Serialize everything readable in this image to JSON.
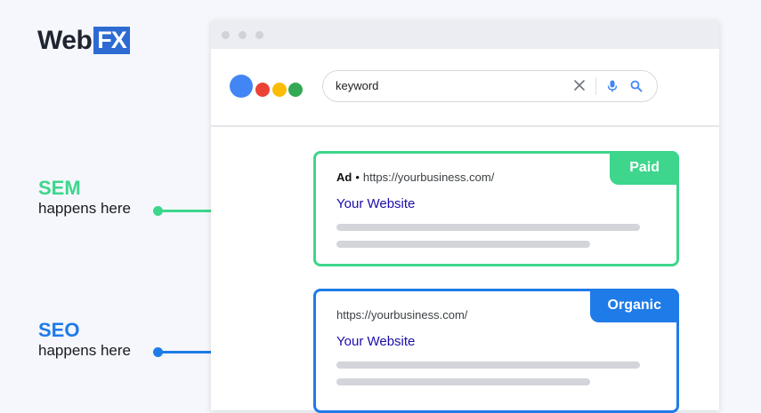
{
  "logo": {
    "text": "Web",
    "box_text": "FX"
  },
  "sem_label": {
    "title": "SEM",
    "subtitle": "happens here",
    "color": "#3dd68c"
  },
  "seo_label": {
    "title": "SEO",
    "subtitle": "happens here",
    "color": "#1f7be8"
  },
  "search": {
    "query": "keyword",
    "icons": [
      "close-icon",
      "microphone-icon",
      "search-icon"
    ]
  },
  "paid_result": {
    "badge": "Paid",
    "ad_label": "Ad",
    "separator": "•",
    "url": "https://yourbusiness.com/",
    "title": "Your Website"
  },
  "organic_result": {
    "badge": "Organic",
    "url": "https://yourbusiness.com/",
    "title": "Your Website"
  },
  "colors": {
    "sem": "#3dd68c",
    "seo": "#1f7be8",
    "link": "#1a0dab",
    "brand_logo": "#2d6bd3"
  }
}
